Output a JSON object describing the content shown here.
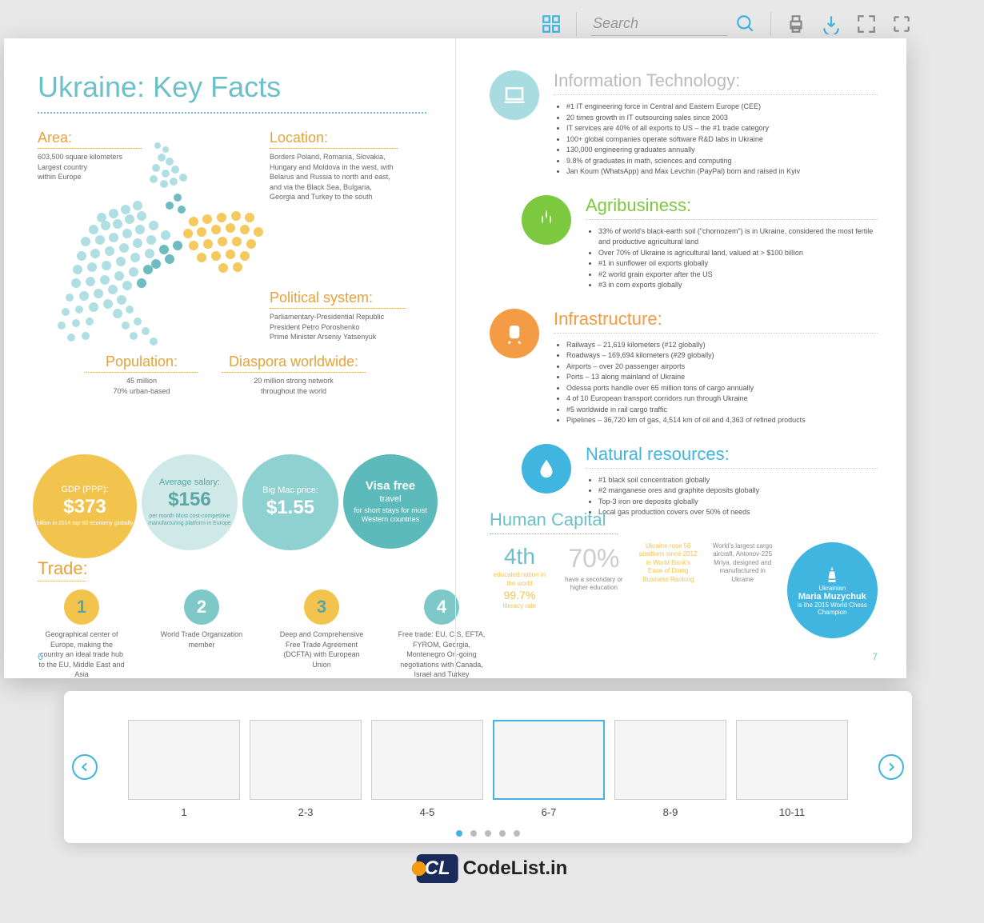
{
  "toolbar": {
    "search_placeholder": "Search"
  },
  "left_page": {
    "title": "Ukraine: Key Facts",
    "area": {
      "heading": "Area:",
      "line1": "603,500 square kilometers",
      "line2": "Largest country",
      "line3": "within Europe"
    },
    "location": {
      "heading": "Location:",
      "text": "Borders Poland, Romania, Slovakia, Hungary and Moldova in the west, with Belarus and Russia to north and east, and via the Black Sea, Bulgaria, Georgia and Turkey to the south"
    },
    "political": {
      "heading": "Political system:",
      "line1": "Parliamentary-Presidential Republic",
      "line2": "President Petro Poroshenko",
      "line3": "Prime Minister Arseniy Yatsenyuk"
    },
    "population": {
      "heading": "Population:",
      "line1": "45 million",
      "line2": "70% urban-based"
    },
    "diaspora": {
      "heading": "Diaspora worldwide:",
      "line1": "20 million strong network",
      "line2": "throughout the world"
    },
    "circles": {
      "gdp": {
        "label": "GDP (PPP):",
        "value": "$373",
        "sub": "billion in 2014 top-50 economy globally"
      },
      "salary": {
        "label": "Average salary:",
        "value": "$156",
        "sub": "per month Most cost-competitive manufacturing platform in Europe"
      },
      "bigmac": {
        "label": "Big Mac price:",
        "value": "$1.55",
        "sub": ""
      },
      "visa": {
        "label": "Visa free",
        "value": "travel",
        "sub": "for short stays for most Western countries"
      }
    },
    "trade": {
      "heading": "Trade:",
      "items": [
        {
          "num": "1",
          "text": "Geographical center of Europe, making the country an ideal trade hub to the EU, Middle East and Asia"
        },
        {
          "num": "2",
          "text": "World Trade Organization member"
        },
        {
          "num": "3",
          "text": "Deep and Comprehensive Free Trade Agreement (DCFTA) with European Union"
        },
        {
          "num": "4",
          "text": "Free trade: EU, CIS, EFTA, FYROM, Georgia, Montenegro On-going negotiations with Canada, Israel and Turkey"
        }
      ]
    },
    "page_number": "6"
  },
  "right_page": {
    "it": {
      "title": "Information Technology:",
      "items": [
        "#1 IT engineering force in Central and Eastern Europe (CEE)",
        "20 times growth in IT outsourcing sales since 2003",
        "IT services are 40% of all exports to US – the #1 trade category",
        "100+ global companies operate software R&D labs in Ukraine",
        "130,000 engineering graduates annually",
        "9.8% of graduates in math, sciences and computing",
        "Jan Koum (WhatsApp) and Max Levchin (PayPal) born and raised in Kyiv"
      ]
    },
    "agri": {
      "title": "Agribusiness:",
      "items": [
        "33% of world's black-earth soil (\"chornozem\") is in Ukraine, considered the most fertile and productive agricultural land",
        "Over 70% of Ukraine is agricultural land, valued at > $100 billion",
        "#1 in sunflower oil exports globally",
        "#2 world grain exporter after the US",
        "#3 in corn exports globally"
      ]
    },
    "infra": {
      "title": "Infrastructure:",
      "items": [
        "Railways – 21,619 kilometers (#12 globally)",
        "Roadways – 169,694 kilometers (#29 globally)",
        "Airports – over 20 passenger airports",
        "Ports – 13 along mainland of Ukraine",
        "Odessa ports handle over 65 million tons of cargo annually",
        "4 of 10 European transport corridors run through Ukraine",
        "#5 worldwide in rail cargo traffic",
        "Pipelines – 36,720 km of gas, 4,514 km of oil and 4,363 of refined products"
      ]
    },
    "natural": {
      "title": "Natural resources:",
      "items": [
        "#1 black soil concentration globally",
        "#2 manganese ores and graphite deposits globally",
        "Top-3 iron ore deposits globally",
        "Local gas production covers over 50% of needs"
      ]
    },
    "human": {
      "title": "Human Capital",
      "fourth": {
        "big": "4th",
        "line1": "educated nation in the world",
        "line2": "99.7%",
        "line3": "literacy rate"
      },
      "seventy": {
        "big": "70%",
        "line1": "have a secondary or higher education"
      },
      "rose": "Ukraine rose 56 positions since 2012 in World Bank's Ease of Doing Business Ranking",
      "cargo": "World's largest cargo aircraft, Antonov-225 Mriya, designed and manufactured in Ukraine",
      "chess": {
        "nat": "Ukrainian",
        "name": "Maria Muzychuk",
        "sub": "is the 2015 World Chess Champion"
      }
    },
    "page_number": "7"
  },
  "thumbnails": {
    "items": [
      {
        "label": "1"
      },
      {
        "label": "2-3"
      },
      {
        "label": "4-5"
      },
      {
        "label": "6-7"
      },
      {
        "label": "8-9"
      },
      {
        "label": "10-11"
      }
    ],
    "active_index": 3
  },
  "logo": {
    "text": "CodeList.in"
  }
}
